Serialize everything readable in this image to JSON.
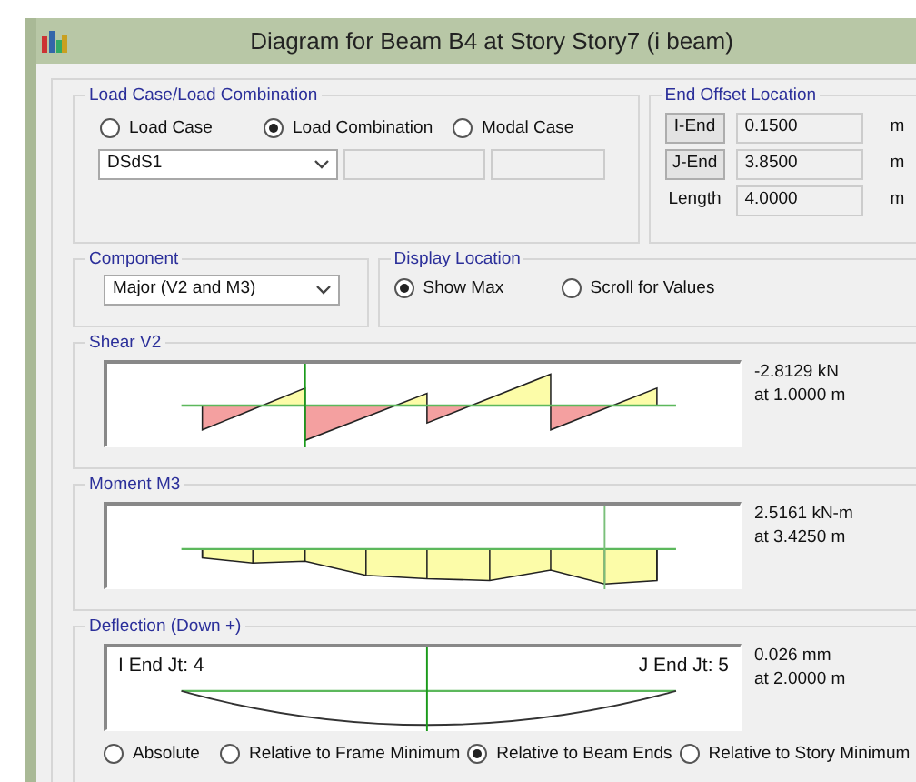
{
  "window": {
    "title": "Diagram for Beam B4 at Story Story7 (i beam)"
  },
  "load_group": {
    "title": "Load Case/Load Combination",
    "options": [
      {
        "label": "Load Case",
        "selected": false
      },
      {
        "label": "Load Combination",
        "selected": true
      },
      {
        "label": "Modal Case",
        "selected": false
      }
    ],
    "combo": {
      "value": "DSdS1"
    },
    "extra_fields": [
      {
        "disabled": true
      },
      {
        "disabled": true
      }
    ]
  },
  "end_offset": {
    "title": "End Offset Location",
    "rows": [
      {
        "kind": "button",
        "label": "I-End",
        "value": "0.1500",
        "unit": "m"
      },
      {
        "kind": "button",
        "label": "J-End",
        "value": "3.8500",
        "unit": "m"
      },
      {
        "kind": "label",
        "label": "Length",
        "value": "4.0000",
        "unit": "m"
      }
    ]
  },
  "component": {
    "title": "Component",
    "value": "Major (V2 and M3)"
  },
  "display_location": {
    "title": "Display Location",
    "options": [
      {
        "label": "Show Max",
        "selected": true
      },
      {
        "label": "Scroll for Values",
        "selected": false
      }
    ]
  },
  "diagrams": [
    {
      "kind": "shear",
      "title": "Shear V2",
      "readout": [
        "-2.8129 kN",
        "at 1.0000 m"
      ]
    },
    {
      "kind": "moment",
      "title": "Moment M3",
      "readout": [
        "2.5161 kN-m",
        "at 3.4250 m"
      ]
    },
    {
      "kind": "deflection",
      "title": "Deflection (Down +)",
      "end_labels": [
        "I End Jt: 4",
        "J End Jt: 5"
      ],
      "readout": [
        "0.026 mm",
        "at 2.0000 m"
      ],
      "options": [
        {
          "label": "Absolute",
          "selected": false
        },
        {
          "label": "Relative to Frame Minimum",
          "selected": false
        },
        {
          "label": "Relative to Beam Ends",
          "selected": true
        },
        {
          "label": "Relative to Story Minimum",
          "selected": false
        }
      ]
    }
  ]
}
